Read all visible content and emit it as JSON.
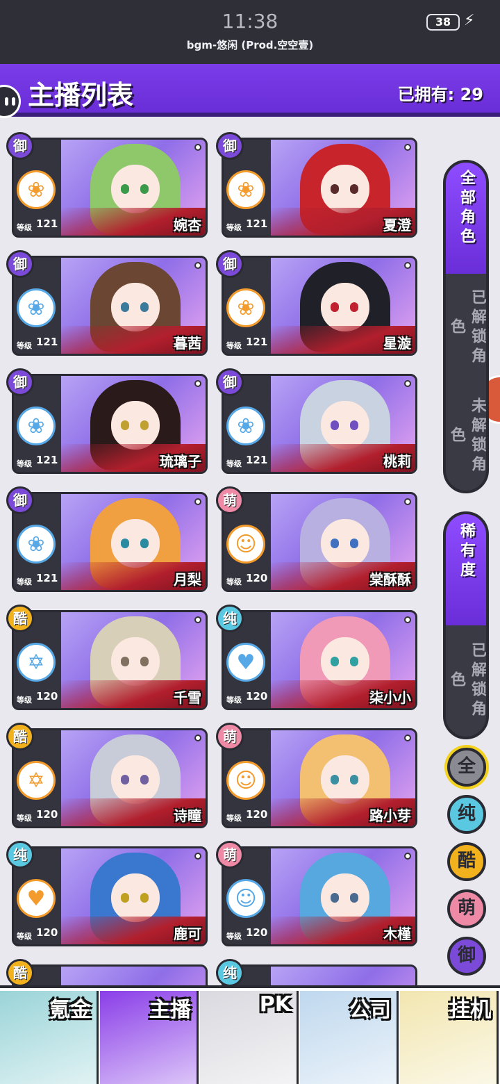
{
  "status_bar": {
    "time": "11:38",
    "music": "bgm-悠闲 (Prod.空空壹)",
    "battery": "38"
  },
  "header": {
    "title": "主播列表",
    "owned": "已拥有: 29"
  },
  "characters": [
    {
      "name": "婉杏",
      "level": "121",
      "type": "御",
      "type_class": "t-yu",
      "skill_icon": "rose-icon",
      "skill_color": "#f39b2c"
    },
    {
      "name": "夏澄",
      "level": "121",
      "type": "御",
      "type_class": "t-yu",
      "skill_icon": "rose-icon",
      "skill_color": "#f39b2c"
    },
    {
      "name": "暮茜",
      "level": "121",
      "type": "御",
      "type_class": "t-yu",
      "skill_icon": "rose-icon",
      "skill_color": "#57a8e6"
    },
    {
      "name": "星漩",
      "level": "121",
      "type": "御",
      "type_class": "t-yu",
      "skill_icon": "rose-icon",
      "skill_color": "#f39b2c"
    },
    {
      "name": "琉璃子",
      "level": "121",
      "type": "御",
      "type_class": "t-yu",
      "skill_icon": "rose-icon",
      "skill_color": "#57a8e6"
    },
    {
      "name": "桃莉",
      "level": "121",
      "type": "御",
      "type_class": "t-yu",
      "skill_icon": "rose-icon",
      "skill_color": "#57a8e6"
    },
    {
      "name": "月梨",
      "level": "121",
      "type": "御",
      "type_class": "t-yu",
      "skill_icon": "rose-icon",
      "skill_color": "#57a8e6"
    },
    {
      "name": "棠酥酥",
      "level": "120",
      "type": "萌",
      "type_class": "t-meng",
      "skill_icon": "cat-icon",
      "skill_color": "#f39b2c"
    },
    {
      "name": "千雪",
      "level": "120",
      "type": "酷",
      "type_class": "t-ku",
      "skill_icon": "star-icon",
      "skill_color": "#57a8e6"
    },
    {
      "name": "柒小小",
      "level": "120",
      "type": "纯",
      "type_class": "t-chun",
      "skill_icon": "heart-pulse-icon",
      "skill_color": "#57a8e6"
    },
    {
      "name": "诗瞳",
      "level": "120",
      "type": "酷",
      "type_class": "t-ku",
      "skill_icon": "star-icon",
      "skill_color": "#f39b2c"
    },
    {
      "name": "路小芽",
      "level": "120",
      "type": "萌",
      "type_class": "t-meng",
      "skill_icon": "cat-icon",
      "skill_color": "#f39b2c"
    },
    {
      "name": "鹿可",
      "level": "120",
      "type": "纯",
      "type_class": "t-chun",
      "skill_icon": "heart-pulse-icon",
      "skill_color": "#f39b2c"
    },
    {
      "name": "木槿",
      "level": "120",
      "type": "萌",
      "type_class": "t-meng",
      "skill_icon": "cat-icon",
      "skill_color": "#57a8e6"
    }
  ],
  "level_label": "等级",
  "partial_row": [
    {
      "type": "酷",
      "type_class": "t-ku"
    },
    {
      "type": "纯",
      "type_class": "t-chun"
    }
  ],
  "filters": {
    "unlock": [
      "全部角色",
      "已解锁角色",
      "未解锁角色"
    ],
    "rarity": [
      "稀有度",
      "已解锁角色"
    ],
    "type_circles": [
      {
        "label": "全",
        "color": "#8a8a92"
      },
      {
        "label": "纯",
        "color": "#5ac8e0"
      },
      {
        "label": "酷",
        "color": "#f2b21e"
      },
      {
        "label": "萌",
        "color": "#ef8aa6"
      },
      {
        "label": "御",
        "color": "#7b4ad9"
      }
    ]
  },
  "bottom_nav": [
    {
      "label": "氪金",
      "icon": "coin-stack-icon",
      "bg": "#9ad4d8"
    },
    {
      "label": "主播",
      "icon": "pig-host-icon",
      "bg": "#8a3ee8"
    },
    {
      "label": "PK",
      "icon": "battle-icon",
      "bg": "#d9d9df"
    },
    {
      "label": "公司",
      "icon": "building-icon",
      "bg": "#bfd8ee"
    },
    {
      "label": "挂机",
      "icon": "piggy-bank-icon",
      "bg": "#f2e6b0"
    }
  ]
}
